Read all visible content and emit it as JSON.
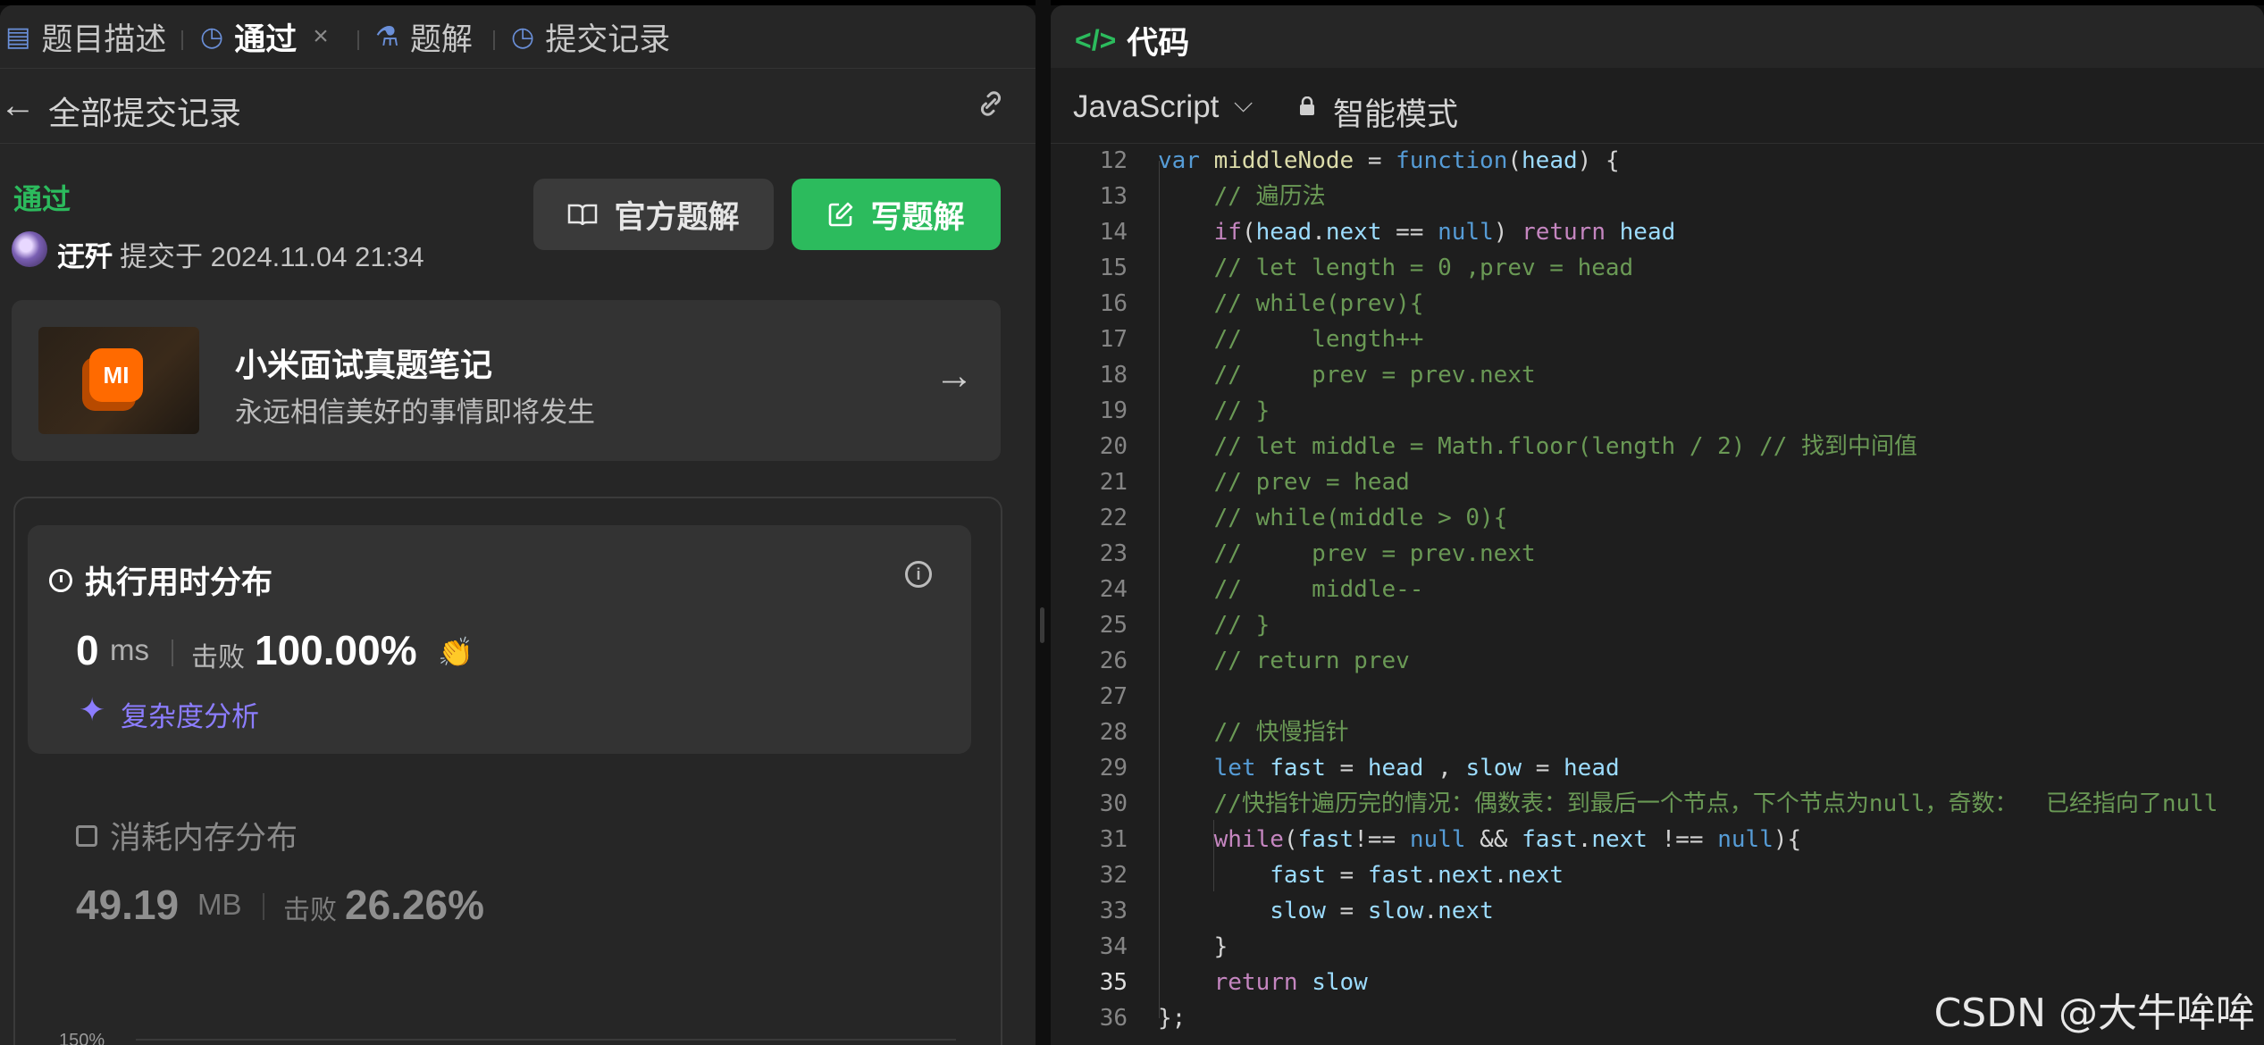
{
  "tabs": [
    {
      "icon": "description-icon",
      "label": "题目描述"
    },
    {
      "icon": "history-icon",
      "label": "通过",
      "active": true,
      "close": "×"
    },
    {
      "icon": "flask-icon",
      "label": "题解"
    },
    {
      "icon": "history-icon",
      "label": "提交记录"
    }
  ],
  "submission_header": {
    "back": "←",
    "title": "全部提交记录"
  },
  "submission": {
    "status": "通过",
    "user": "迂歼",
    "submitted_text": "提交于 2024.11.04 21:34",
    "official_solution_label": "官方题解",
    "write_solution_label": "写题解"
  },
  "promo": {
    "logo_text": "MI",
    "title": "小米面试真题笔记",
    "subtitle": "永远相信美好的事情即将发生",
    "arrow": "→"
  },
  "runtime": {
    "title": "执行用时分布",
    "value": "0",
    "unit": "ms",
    "beat_label": "击败",
    "beat_value": "100.00%",
    "complexity_label": "复杂度分析",
    "info": "i"
  },
  "memory": {
    "title": "消耗内存分布",
    "value": "49.19",
    "unit": "MB",
    "beat_label": "击败",
    "beat_value": "26.26%",
    "y_tick": "150%"
  },
  "code_panel": {
    "title": "代码",
    "title_icon": "</>",
    "language": "JavaScript",
    "chevron": "⌵",
    "mode": "智能模式"
  },
  "code_lines": [
    {
      "n": "12"
    },
    {
      "n": "13"
    },
    {
      "n": "14"
    },
    {
      "n": "15"
    },
    {
      "n": "16"
    },
    {
      "n": "17"
    },
    {
      "n": "18"
    },
    {
      "n": "19"
    },
    {
      "n": "20"
    },
    {
      "n": "21"
    },
    {
      "n": "22"
    },
    {
      "n": "23"
    },
    {
      "n": "24"
    },
    {
      "n": "25"
    },
    {
      "n": "26"
    },
    {
      "n": "27"
    },
    {
      "n": "28"
    },
    {
      "n": "29"
    },
    {
      "n": "30"
    },
    {
      "n": "31"
    },
    {
      "n": "32"
    },
    {
      "n": "33"
    },
    {
      "n": "34"
    },
    {
      "n": "35"
    },
    {
      "n": "36"
    }
  ],
  "code_text": {
    "l12": [
      "var",
      " ",
      "middleNode",
      " = ",
      "function",
      "(",
      "head",
      ") {"
    ],
    "l13": "    // 遍历法",
    "l14": [
      "    ",
      "if",
      "(",
      "head",
      ".",
      "next",
      " == ",
      "null",
      ") ",
      "return",
      " ",
      "head"
    ],
    "l15": "    // let length = 0 ,prev = head",
    "l16": "    // while(prev){",
    "l17": "    //     length++",
    "l18": "    //     prev = prev.next",
    "l19": "    // }",
    "l20": "    // let middle = Math.floor(length / 2) // 找到中间值",
    "l21": "    // prev = head",
    "l22": "    // while(middle > 0){",
    "l23": "    //     prev = prev.next",
    "l24": "    //     middle--",
    "l25": "    // }",
    "l26": "    // return prev",
    "l27": "",
    "l28": "    // 快慢指针",
    "l29": [
      "    ",
      "let",
      " ",
      "fast",
      " = ",
      "head",
      " , ",
      "slow",
      " = ",
      "head"
    ],
    "l30": "    //快指针遍历完的情况：偶数表：到最后一个节点，下个节点为null，奇数：  已经指向了null",
    "l31": [
      "    ",
      "while",
      "(",
      "fast",
      "!== ",
      "null",
      " && ",
      "fast",
      ".",
      "next",
      " !== ",
      "null",
      "){"
    ],
    "l32": [
      "        ",
      "fast",
      " = ",
      "fast",
      ".",
      "next",
      ".",
      "next"
    ],
    "l33": [
      "        ",
      "slow",
      " = ",
      "slow",
      ".",
      "next"
    ],
    "l34": "    }",
    "l35": [
      "    ",
      "return",
      " ",
      "slow"
    ],
    "l36": "};"
  },
  "watermark": "CSDN @大牛哞哞"
}
